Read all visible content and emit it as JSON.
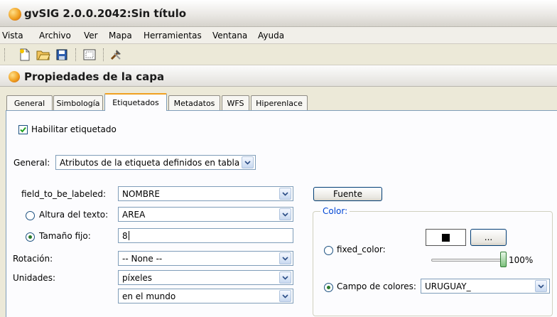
{
  "window": {
    "title": "gvSIG 2.0.0.2042:Sin título"
  },
  "menubar": {
    "items": [
      "Vista",
      "Archivo",
      "Ver",
      "Mapa",
      "Herramientas",
      "Ventana",
      "Ayuda"
    ]
  },
  "toolbar": {
    "buttons": [
      "new-document-icon",
      "open-folder-icon",
      "save-disk-icon",
      "map-frame-icon",
      "tools-icon"
    ]
  },
  "panel": {
    "title": "Propiedades de la capa"
  },
  "tabs": [
    "General",
    "Simbología",
    "Etiquetados",
    "Metadatos",
    "WFS",
    "Hiperenlace"
  ],
  "active_tab": "Etiquetados",
  "labeling": {
    "enable_label": "Habilitar etiquetado",
    "enable_checked": true,
    "general_label": "General:",
    "general_value": "Atributos de la etiqueta definidos en tabla",
    "field_label": "field_to_be_labeled:",
    "field_value": "NOMBRE",
    "text_height_label": "Altura del texto:",
    "text_height_value": "AREA",
    "fixed_size_label": "Tamaño fijo:",
    "fixed_size_value": "8",
    "rotation_label": "Rotación:",
    "rotation_value": "-- None --",
    "units_label": "Unidades:",
    "units_value": "píxeles",
    "units_ref_value": "en el mundo",
    "font_button": "Fuente",
    "color_group": "Color:",
    "fixed_color_label": "fixed_color:",
    "color_browse": "...",
    "transparency": "100%",
    "color_field_label": "Campo de colores:",
    "color_field_value": "URUGUAY_",
    "swatch_color": "#000000"
  },
  "colors": {
    "accent_tab": "#f0a020",
    "field_border": "#7f9db9",
    "group_title": "#0046d5"
  }
}
